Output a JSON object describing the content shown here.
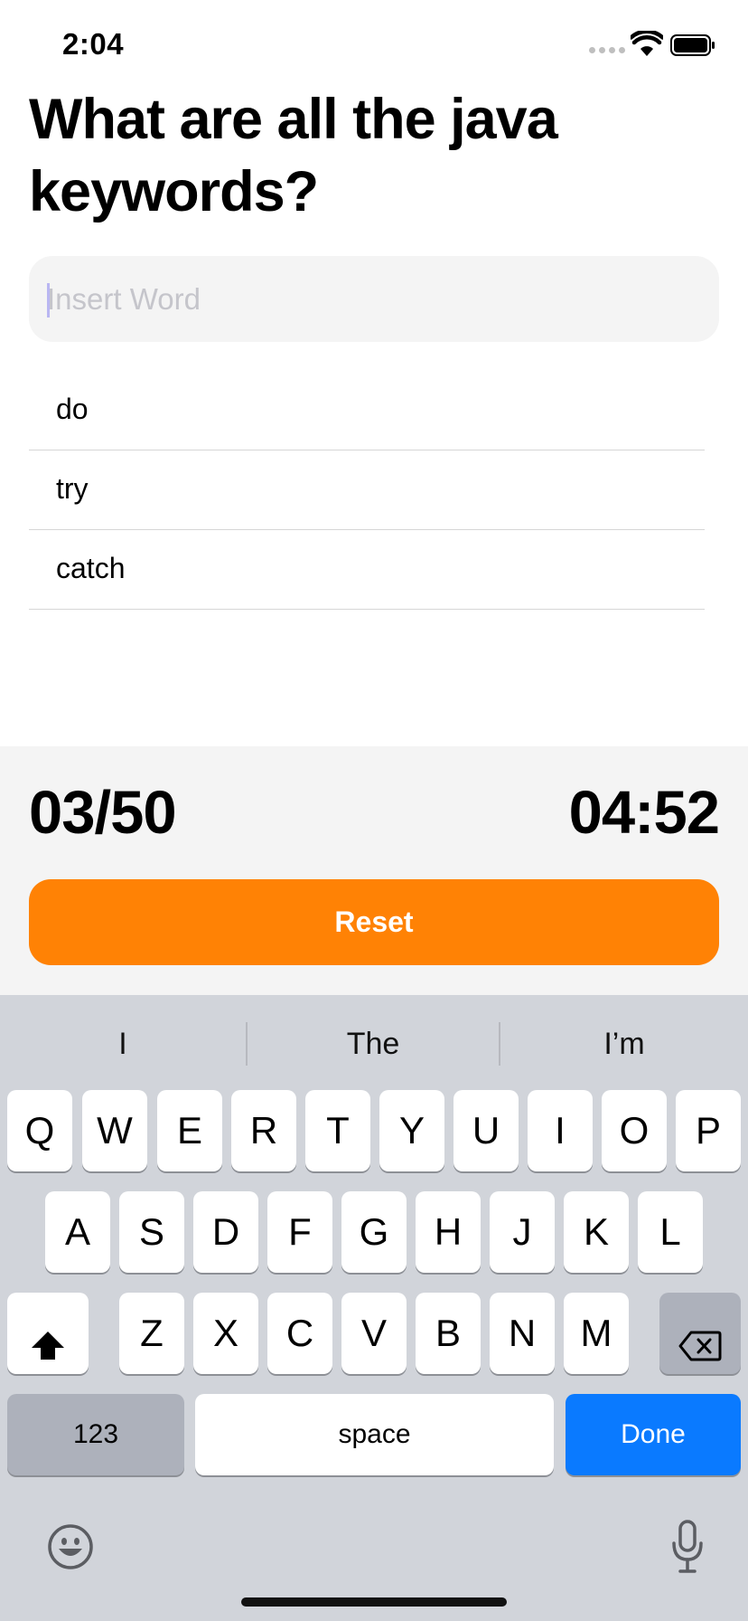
{
  "status_bar": {
    "time": "2:04",
    "icons": [
      "cellular-signal-icon",
      "wifi-icon",
      "battery-icon"
    ]
  },
  "question": {
    "title": "What are all the java keywords?"
  },
  "input": {
    "placeholder": "Insert Word",
    "value": ""
  },
  "words": [
    {
      "label": "do"
    },
    {
      "label": "try"
    },
    {
      "label": "catch"
    }
  ],
  "score": {
    "count": "03/50",
    "timer": "04:52"
  },
  "reset_button": {
    "label": "Reset",
    "color": "#ff8205"
  },
  "keyboard": {
    "suggestions": [
      "I",
      "The",
      "I’m"
    ],
    "row1": [
      "Q",
      "W",
      "E",
      "R",
      "T",
      "Y",
      "U",
      "I",
      "O",
      "P"
    ],
    "row2": [
      "A",
      "S",
      "D",
      "F",
      "G",
      "H",
      "J",
      "K",
      "L"
    ],
    "row3": [
      "Z",
      "X",
      "C",
      "V",
      "B",
      "N",
      "M"
    ],
    "numbers_key": "123",
    "space_key": "space",
    "done_key": "Done",
    "done_color": "#0a7aff",
    "icons": [
      "shift-icon",
      "delete-icon",
      "emoji-icon",
      "microphone-icon"
    ]
  }
}
